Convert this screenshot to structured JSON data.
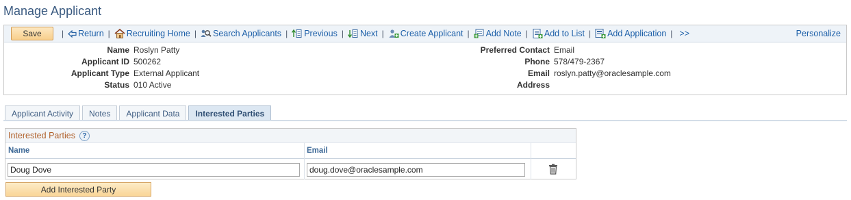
{
  "page": {
    "title": "Manage Applicant"
  },
  "toolbar": {
    "save": "Save",
    "separator": "|",
    "links": [
      {
        "label": "Return",
        "icon": "return-arrow-icon"
      },
      {
        "label": "Recruiting Home",
        "icon": "home-icon"
      },
      {
        "label": "Search Applicants",
        "icon": "search-people-icon"
      },
      {
        "label": "Previous",
        "icon": "previous-icon"
      },
      {
        "label": "Next",
        "icon": "next-icon"
      },
      {
        "label": "Create Applicant",
        "icon": "create-person-icon"
      },
      {
        "label": "Add Note",
        "icon": "add-note-icon"
      },
      {
        "label": "Add to List",
        "icon": "add-to-list-icon"
      },
      {
        "label": "Add Application",
        "icon": "add-application-icon"
      }
    ],
    "more": ">>",
    "personalize": "Personalize"
  },
  "summary": {
    "left": [
      {
        "label": "Name",
        "value": "Roslyn Patty"
      },
      {
        "label": "Applicant ID",
        "value": "500262"
      },
      {
        "label": "Applicant Type",
        "value": "External Applicant"
      },
      {
        "label": "Status",
        "value": "010 Active"
      }
    ],
    "right": [
      {
        "label": "Preferred Contact",
        "value": "Email"
      },
      {
        "label": "Phone",
        "value": "578/479-2367"
      },
      {
        "label": "Email",
        "value": "roslyn.patty@oraclesample.com"
      },
      {
        "label": "Address",
        "value": ""
      }
    ]
  },
  "tabs": [
    {
      "label": "Applicant Activity",
      "active": false
    },
    {
      "label": "Notes",
      "active": false
    },
    {
      "label": "Applicant Data",
      "active": false
    },
    {
      "label": "Interested Parties",
      "active": true
    }
  ],
  "interested_parties": {
    "title": "Interested Parties",
    "help": "?",
    "columns": {
      "name": "Name",
      "email": "Email"
    },
    "rows": [
      {
        "name": "Doug Dove",
        "email": "doug.dove@oraclesample.com"
      }
    ],
    "add_button": "Add Interested Party"
  },
  "colors": {
    "title": "#3a5a80",
    "link": "#1c5fa8",
    "grid_title": "#b0612b",
    "button": "#f8cf8c"
  }
}
